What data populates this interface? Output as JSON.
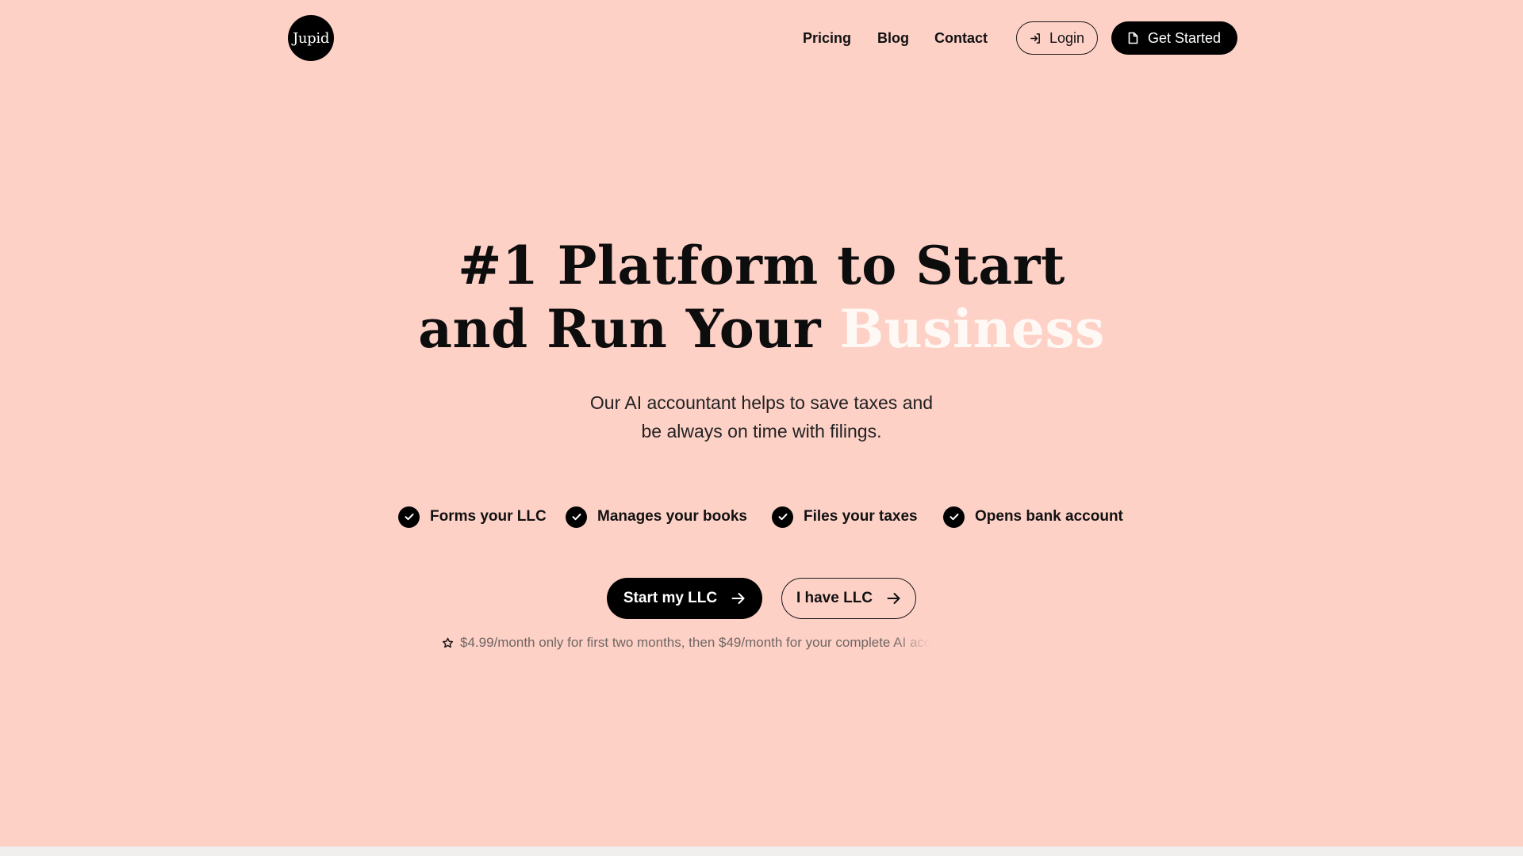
{
  "nav": {
    "logo_text": "Jupid",
    "links": [
      "Pricing",
      "Blog",
      "Contact"
    ],
    "login_label": "Login",
    "get_started_label": "Get Started"
  },
  "hero": {
    "title_line1": "#1 Platform to Start",
    "title_line2_prefix": "and Run Your ",
    "title_accent": "Business",
    "subtitle_line1": "Our AI accountant helps to save taxes and",
    "subtitle_line2": "be always on time with filings."
  },
  "features": [
    "Forms your LLC",
    "Manages your books",
    "Files your taxes",
    "Opens bank account"
  ],
  "cta": {
    "primary_label": "Start my LLC",
    "secondary_label": "I have LLC"
  },
  "pricing_note": "$4.99/month only for first two months, then $49/month for your complete AI acc",
  "colors": {
    "background": "#fed1c7",
    "accent_text": "#fff9f5",
    "primary": "#000000"
  }
}
